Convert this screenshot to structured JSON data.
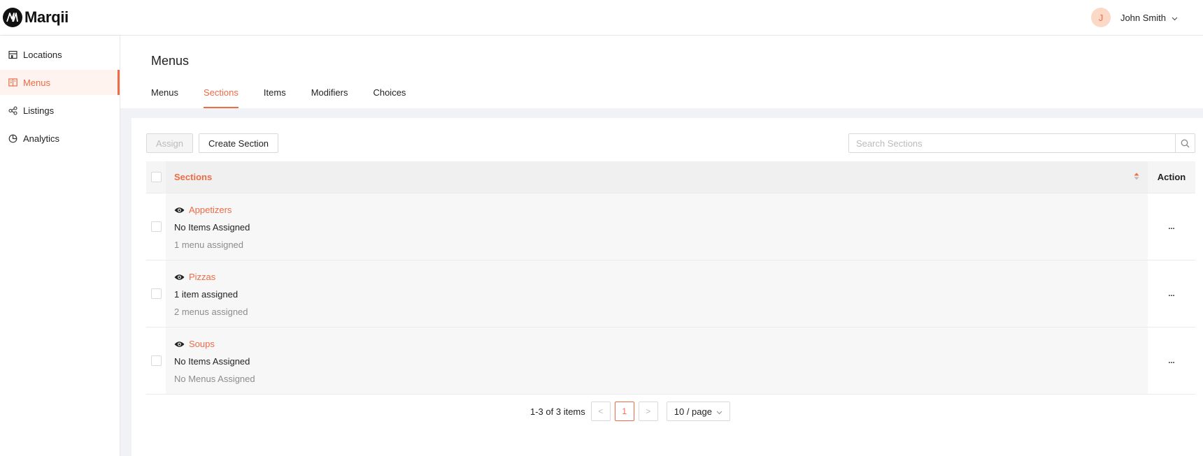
{
  "brand": {
    "name": "Marqii"
  },
  "user": {
    "initial": "J",
    "name": "John Smith"
  },
  "sidebar": {
    "items": [
      {
        "label": "Locations",
        "icon": "store-icon",
        "active": false
      },
      {
        "label": "Menus",
        "icon": "menu-book-icon",
        "active": true
      },
      {
        "label": "Listings",
        "icon": "share-nodes-icon",
        "active": false
      },
      {
        "label": "Analytics",
        "icon": "pie-chart-icon",
        "active": false
      }
    ]
  },
  "page": {
    "title": "Menus",
    "tabs": [
      {
        "label": "Menus",
        "active": false
      },
      {
        "label": "Sections",
        "active": true
      },
      {
        "label": "Items",
        "active": false
      },
      {
        "label": "Modifiers",
        "active": false
      },
      {
        "label": "Choices",
        "active": false
      }
    ]
  },
  "toolbar": {
    "assign_label": "Assign",
    "create_label": "Create Section",
    "search_placeholder": "Search Sections"
  },
  "table": {
    "columns": {
      "sections": "Sections",
      "action": "Action"
    },
    "rows": [
      {
        "name": "Appetizers",
        "items": "No Items Assigned",
        "menus": "1 menu assigned",
        "action": "..."
      },
      {
        "name": "Pizzas",
        "items": "1 item assigned",
        "menus": "2 menus assigned",
        "action": "..."
      },
      {
        "name": "Soups",
        "items": "No Items Assigned",
        "menus": "No Menus Assigned",
        "action": "..."
      }
    ]
  },
  "pagination": {
    "total_text": "1-3 of 3 items",
    "prev": "<",
    "current_page": "1",
    "next": ">",
    "page_size": "10 / page"
  },
  "colors": {
    "accent": "#ef6a45"
  }
}
